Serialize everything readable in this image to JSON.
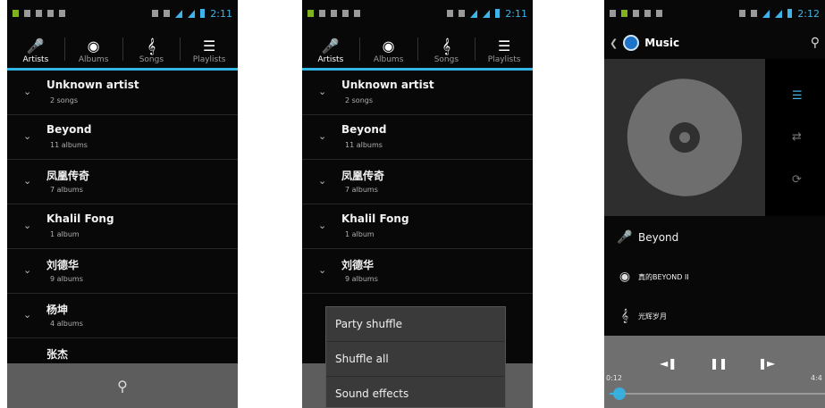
{
  "phones": [
    {
      "status_time": "2:11",
      "tabs": [
        {
          "label": "Artists",
          "icon": "microphone-icon"
        },
        {
          "label": "Albums",
          "icon": "disc-icon"
        },
        {
          "label": "Songs",
          "icon": "music-note-icon"
        },
        {
          "label": "Playlists",
          "icon": "list-icon"
        }
      ],
      "artists": [
        {
          "name": "Unknown artist",
          "sub": "2 songs"
        },
        {
          "name": "Beyond",
          "sub": "11 albums"
        },
        {
          "name": "凤凰传奇",
          "sub": "7 albums"
        },
        {
          "name": "Khalil Fong",
          "sub": "1 album"
        },
        {
          "name": "刘德华",
          "sub": "9 albums"
        },
        {
          "name": "杨坤",
          "sub": "4 albums"
        },
        {
          "name": "张杰",
          "sub": ""
        }
      ]
    },
    {
      "status_time": "2:11",
      "tabs": [
        {
          "label": "Artists"
        },
        {
          "label": "Albums"
        },
        {
          "label": "Songs"
        },
        {
          "label": "Playlists"
        }
      ],
      "artists": [
        {
          "name": "Unknown artist",
          "sub": "2 songs"
        },
        {
          "name": "Beyond",
          "sub": "11 albums"
        },
        {
          "name": "凤凰传奇",
          "sub": "7 albums"
        },
        {
          "name": "Khalil Fong",
          "sub": "1 album"
        },
        {
          "name": "刘德华",
          "sub": "9 albums"
        }
      ],
      "menu": [
        "Party shuffle",
        "Shuffle all",
        "Sound effects"
      ]
    },
    {
      "status_time": "2:12",
      "title": "Music",
      "artist": "Beyond",
      "album": "真的BEYOND II",
      "song": "光辉岁月",
      "elapsed": "0:12",
      "total": "4:4",
      "progress": 0.05
    }
  ],
  "colors": {
    "accent": "#33b5e5",
    "status_green": "#7fb21c"
  }
}
